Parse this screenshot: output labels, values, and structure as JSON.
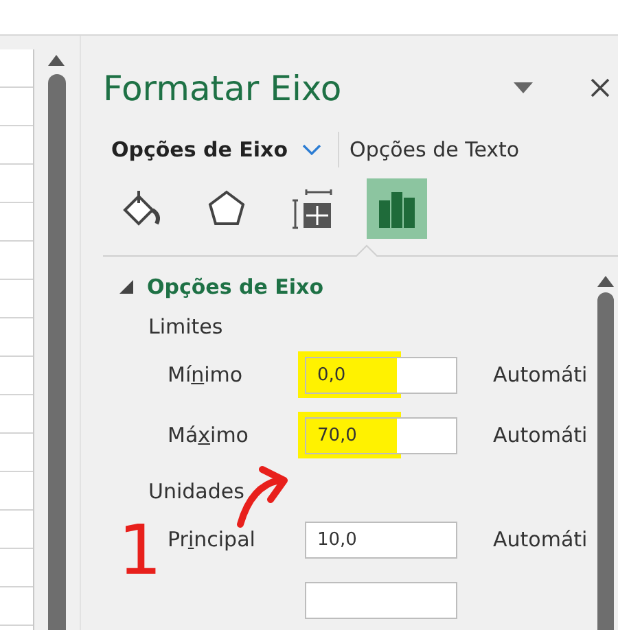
{
  "panel": {
    "title": "Formatar Eixo",
    "tabs": [
      {
        "label": "Opções de Eixo",
        "selected": true
      },
      {
        "label": "Opções de Texto",
        "selected": false
      }
    ],
    "icon_tabs": [
      {
        "kind": "fill",
        "selected": false
      },
      {
        "kind": "shape",
        "selected": false
      },
      {
        "kind": "size",
        "selected": false
      },
      {
        "kind": "axis",
        "selected": true
      }
    ],
    "section": {
      "title": "Opções de Eixo",
      "expanded": true,
      "groups": [
        {
          "heading": "Limites",
          "rows": [
            {
              "kind": "field",
              "label_start": "Mí",
              "access_key": "n",
              "label_end": "imo",
              "value": "0,0",
              "highlighted": true,
              "auto": "Automáti"
            },
            {
              "kind": "field",
              "label_start": "Má",
              "access_key": "x",
              "label_end": "imo",
              "value": "70,0",
              "highlighted": true,
              "auto": "Automáti"
            }
          ]
        },
        {
          "heading": "Unidades",
          "rows": [
            {
              "kind": "field",
              "label_start": "Pr",
              "access_key": "i",
              "label_end": "ncipal",
              "value": "10,0",
              "highlighted": false,
              "auto": "Automáti"
            },
            {
              "kind": "cut"
            }
          ]
        }
      ]
    }
  },
  "annotation": {
    "text": "1"
  }
}
